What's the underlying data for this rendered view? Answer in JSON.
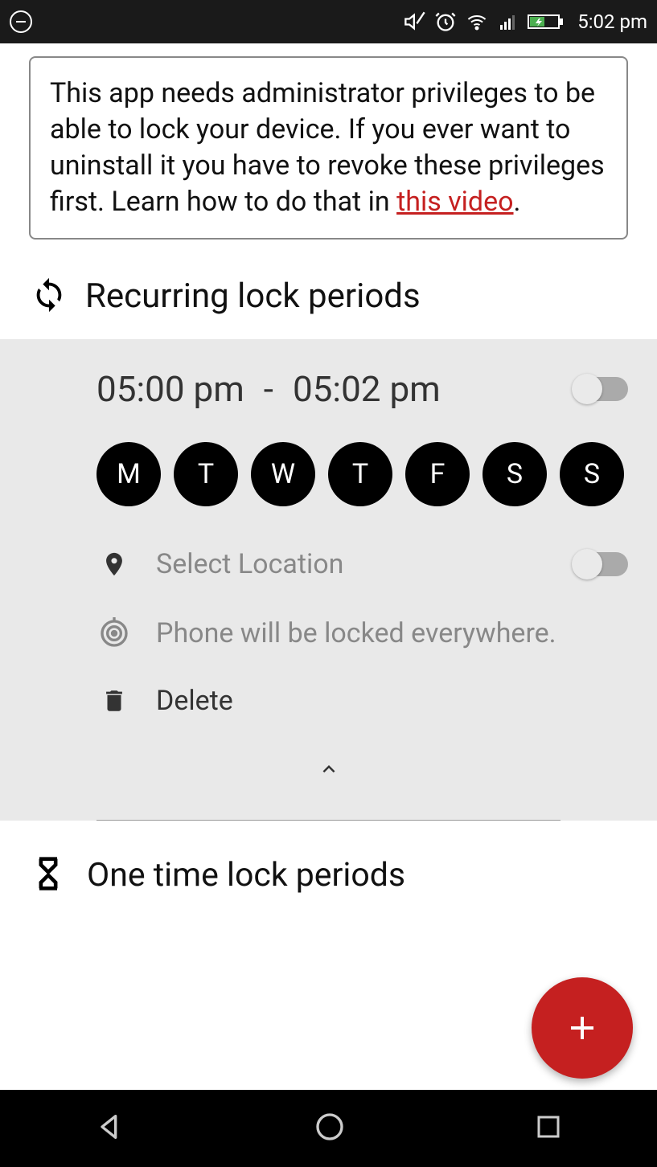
{
  "status": {
    "time": "5:02 pm"
  },
  "info": {
    "text_before_link": "This app needs administrator privileges to be able to lock your device. If you ever want to uninstall it you have to revoke these privileges first. Learn how to do that in ",
    "link_text": "this video",
    "text_after_link": "."
  },
  "sections": {
    "recurring_title": "Recurring lock periods",
    "onetime_title": "One time lock periods"
  },
  "period": {
    "start_time": "05:00 pm",
    "end_time": "05:02 pm",
    "days": [
      "M",
      "T",
      "W",
      "T",
      "F",
      "S",
      "S"
    ],
    "select_location_label": "Select Location",
    "locked_everywhere_label": "Phone will be locked everywhere.",
    "delete_label": "Delete"
  }
}
